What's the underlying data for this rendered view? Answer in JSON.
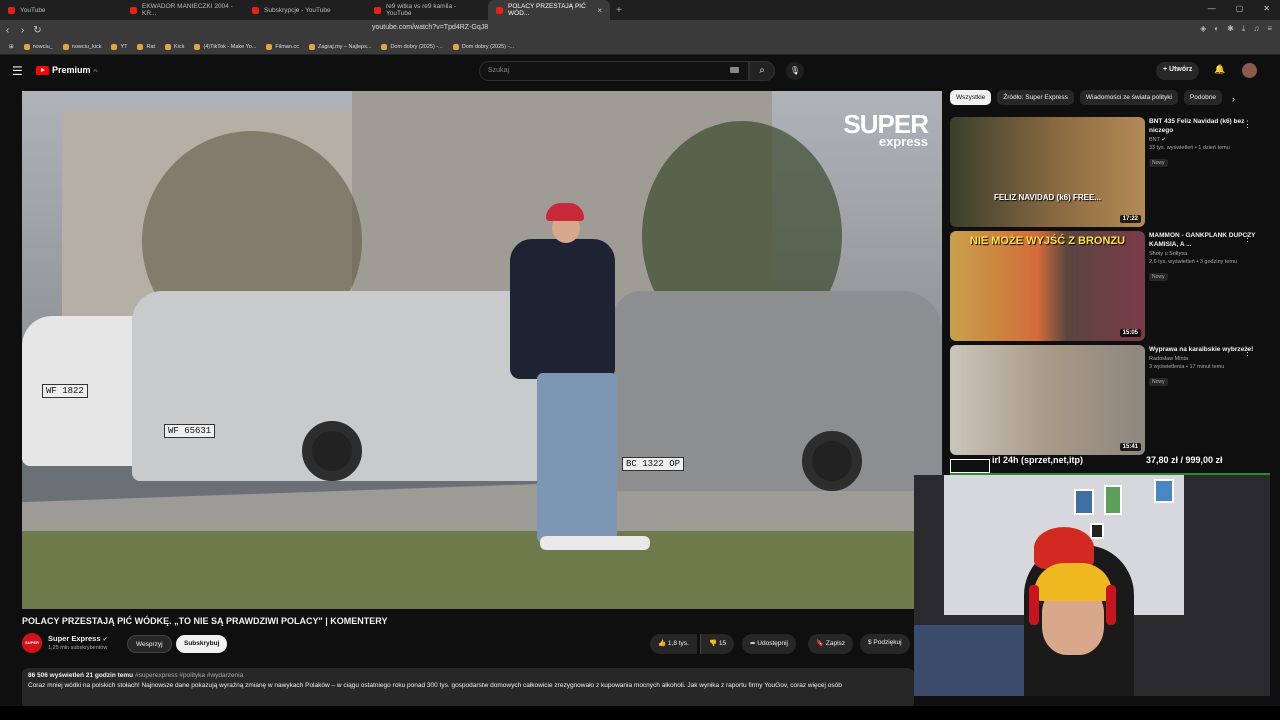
{
  "browser": {
    "tabs": [
      {
        "label": "YouTube"
      },
      {
        "label": "EKWADOR MANIECZKI 2004 - KR..."
      },
      {
        "label": "Subskrypcje - YouTube"
      },
      {
        "label": "re9 witka vs re9 kamila - YouTube"
      },
      {
        "label": "POLACY PRZESTAJĄ PIĆ WÓD..."
      }
    ],
    "active_tab_close": "×",
    "new_tab": "+",
    "url": "youtube.com/watch?v=Tpd4RZ-GqJ8",
    "bookmarks": [
      {
        "label": "nowciu_"
      },
      {
        "label": "nowciu_kick"
      },
      {
        "label": "YT"
      },
      {
        "label": "Rat"
      },
      {
        "label": "Kick"
      },
      {
        "label": "(4)TikTok - Make Yo..."
      },
      {
        "label": "Filman.cc"
      },
      {
        "label": "Zagraj.my – Najleps..."
      },
      {
        "label": "Dom dobry (2025) -..."
      },
      {
        "label": "Dom dobry (2025) -..."
      }
    ]
  },
  "header": {
    "logo_text": "Premium",
    "logo_region": "PL",
    "search_placeholder": "Szukaj",
    "create_label": "Utwórz"
  },
  "player": {
    "brand_line1": "SUPER",
    "brand_line2": "express",
    "plates": [
      "WF 65631",
      "BC 1322 OP",
      "WF 1822"
    ]
  },
  "video": {
    "title": "POLACY PRZESTAJĄ PIĆ WÓDKĘ. „TO NIE SĄ PRAWDZIWI POLACY\" | KOMENTERY",
    "channel_avatar_text": "SUPER",
    "channel_name": "Super Express",
    "channel_verified": "✔",
    "subscribers": "1,25 mln subskrybentów",
    "support_label": "Wesprzyj",
    "subscribe_label": "Subskrybuj",
    "likes": "1,8 tys.",
    "dislikes": "15",
    "share_label": "Udostępnij",
    "save_label": "Zapisz",
    "thanks_label": "Podziękuj",
    "views": "86 506 wyświetleń",
    "age": "21 godzin temu",
    "hashtags": "#superexpress #polityka #wydarzenia",
    "description": "Coraz mniej wódki na polskich stołach! Najnowsze dane pokazują wyraźną zmianę w nawykach Polaków – w ciągu ostatniego roku ponad 300 tys. gospodarstw domowych całkowicie zrezygnowało z kupowania mocnych alkoholi. Jak wynika z raportu firmy YouGov, coraz więcej osób"
  },
  "filters": {
    "chips": [
      "Wszystkie",
      "Źródło: Super Express",
      "Wiadomości ze świata polityki",
      "Podobne"
    ],
    "active_index": 0,
    "next_icon": "chevron-right"
  },
  "recommendations": [
    {
      "title": "BNT 435 Feliz Navidad (k6) bez niczego",
      "channel": "BNT",
      "meta": "33 tys. wyświetleń • 1 dzień temu",
      "badge": "Nowy",
      "duration": "17:22",
      "thumb_text": "FELIZ NAVIDAD (k6) FREE..."
    },
    {
      "title": "MAMMON - GANKPLANK DUPCZY KAMISIA, A ...",
      "channel": "Shoty u Sołtysa",
      "meta": "2,6 tys. wyświetleń • 3 godziny temu",
      "badge": "Nowy",
      "duration": "15:05",
      "thumb_text": "NIE MOŻE WYJŚĆ Z BRONZU"
    },
    {
      "title": "Wyprawa na karaibskie wybrzeże!",
      "channel": "Radosław Minta",
      "meta": "3 wyświetlenia • 17 minut temu",
      "badge": "Nowy",
      "duration": "15:41",
      "thumb_text": ""
    }
  ],
  "overlay": {
    "ticker_left": "irl 24h (sprzet,net,itp)",
    "ticker_right": "37,80 zł / 999,00 zł"
  },
  "colors": {
    "background": "#0f0f0f",
    "accent_red": "#ff0000",
    "chip_bg": "#272727"
  }
}
